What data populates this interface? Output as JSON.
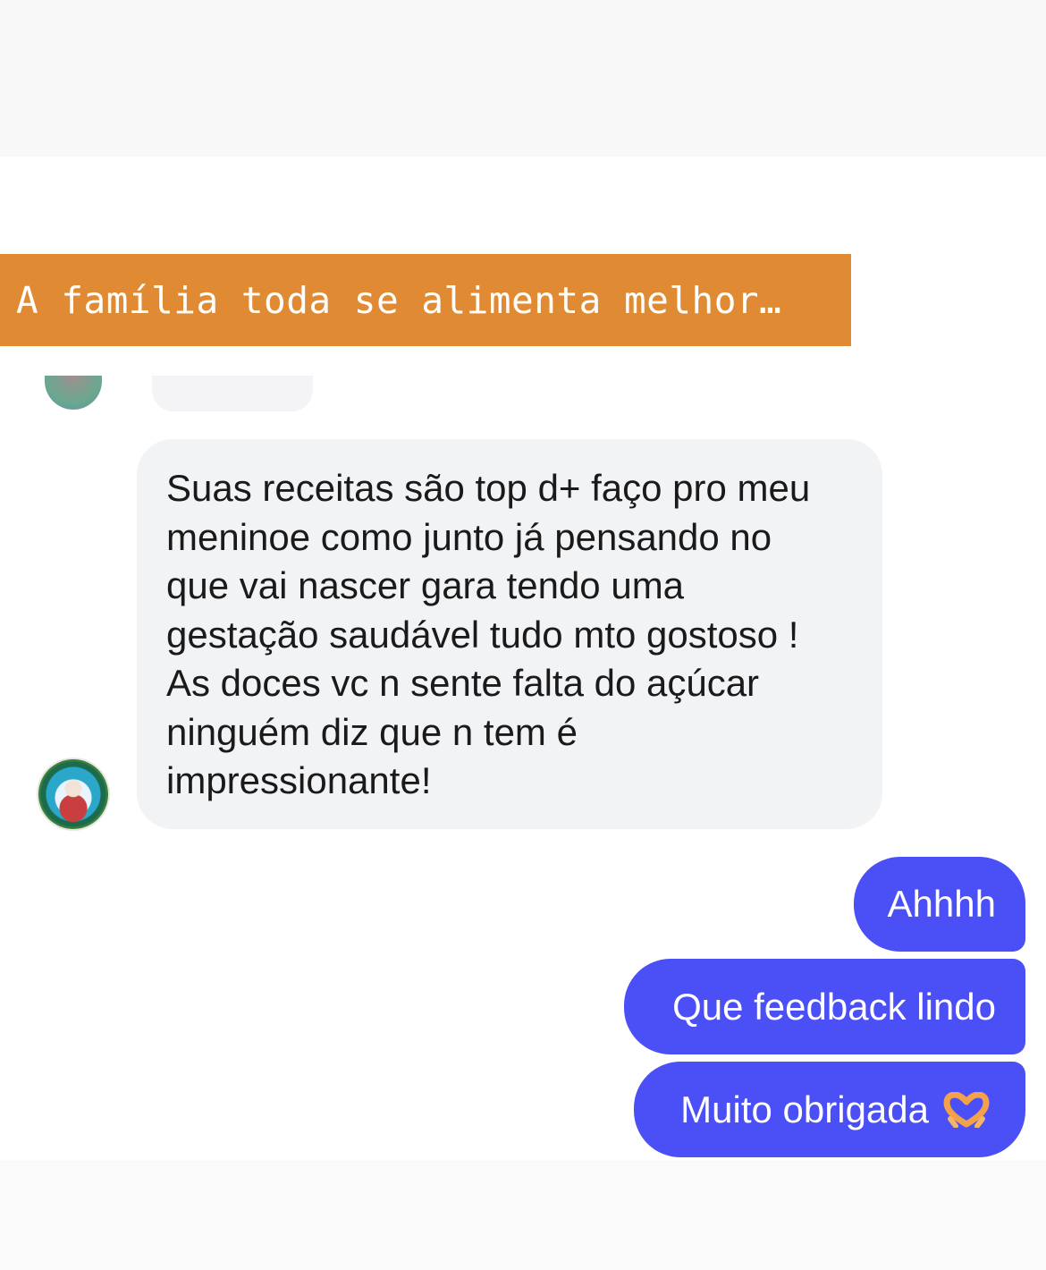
{
  "caption": {
    "text": "A família toda se alimenta melhor…"
  },
  "incoming_message": {
    "text": "Suas receitas são top d+ faço pro meu\nmeninoe como junto já pensando no\nque vai nascer gara tendo uma\ngestação saudável tudo mto gostoso !\nAs doces vc n sente falta do açúcar\nninguém diz que n tem é\nimpressionante!"
  },
  "outgoing_messages": [
    {
      "text": "Ahhhh"
    },
    {
      "text": "Que feedback lindo"
    },
    {
      "text": "Muito obrigada",
      "emoji_icon": "heart-hands-icon"
    }
  ],
  "colors": {
    "caption_background": "#e08b33",
    "outgoing_bubble": "#4a4ff6",
    "incoming_bubble": "#f2f3f5"
  }
}
